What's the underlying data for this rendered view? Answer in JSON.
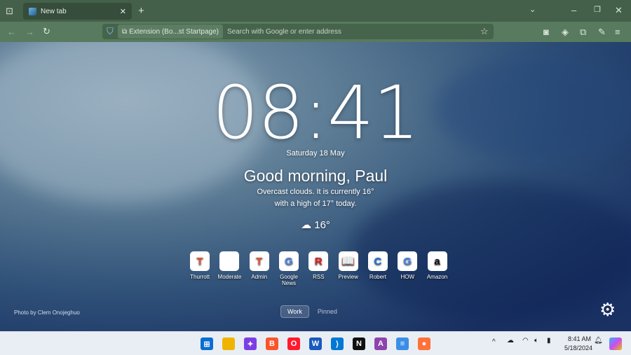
{
  "browser": {
    "tab_title": "New tab",
    "identity_label": "Extension (Bo...st Startpage)",
    "address_placeholder": "Search with Google or enter address"
  },
  "page": {
    "time": "08:41",
    "date": "Saturday 18 May",
    "greeting": "Good morning, Paul",
    "weather_line1": "Overcast clouds. It is currently 16°",
    "weather_line2": "with a high of 17° today.",
    "temperature": "16°",
    "photo_credit": "Photo by Clem Onojeghuo",
    "links": [
      {
        "label": "Thurrott",
        "icon": "T",
        "color": "#e53"
      },
      {
        "label": "Moderate",
        "icon": "",
        "color": "#ccc"
      },
      {
        "label": "Admin",
        "icon": "T",
        "color": "#e53"
      },
      {
        "label": "Google News",
        "icon": "G",
        "color": "#4285f4"
      },
      {
        "label": "RSS",
        "icon": "R",
        "color": "#e02020"
      },
      {
        "label": "Preview",
        "icon": "📖",
        "color": "#222"
      },
      {
        "label": "Robert",
        "icon": "C",
        "color": "#1a73e8"
      },
      {
        "label": "HOW",
        "icon": "G",
        "color": "#4285f4"
      },
      {
        "label": "Amazon",
        "icon": "a",
        "color": "#111"
      }
    ],
    "tabs": {
      "active": "Work",
      "other": "Pinned"
    }
  },
  "taskbar": {
    "time": "8:41 AM",
    "date": "5/18/2024",
    "apps": [
      {
        "name": "start",
        "color": "#0a6ed1",
        "glyph": "⊞"
      },
      {
        "name": "file-explorer",
        "color": "#f0b400",
        "glyph": ""
      },
      {
        "name": "app-3",
        "color": "#7b3fe4",
        "glyph": "✦"
      },
      {
        "name": "brave",
        "color": "#fb542b",
        "glyph": "B"
      },
      {
        "name": "opera",
        "color": "#ff1b2d",
        "glyph": "O"
      },
      {
        "name": "word",
        "color": "#185abd",
        "glyph": "W"
      },
      {
        "name": "vscode",
        "color": "#0078d4",
        "glyph": "⟩"
      },
      {
        "name": "notion",
        "color": "#111",
        "glyph": "N"
      },
      {
        "name": "affinity",
        "color": "#8e44ad",
        "glyph": "A"
      },
      {
        "name": "notepad",
        "color": "#3a8ee6",
        "glyph": "≡"
      },
      {
        "name": "firefox",
        "color": "#ff7139",
        "glyph": "●"
      }
    ]
  }
}
